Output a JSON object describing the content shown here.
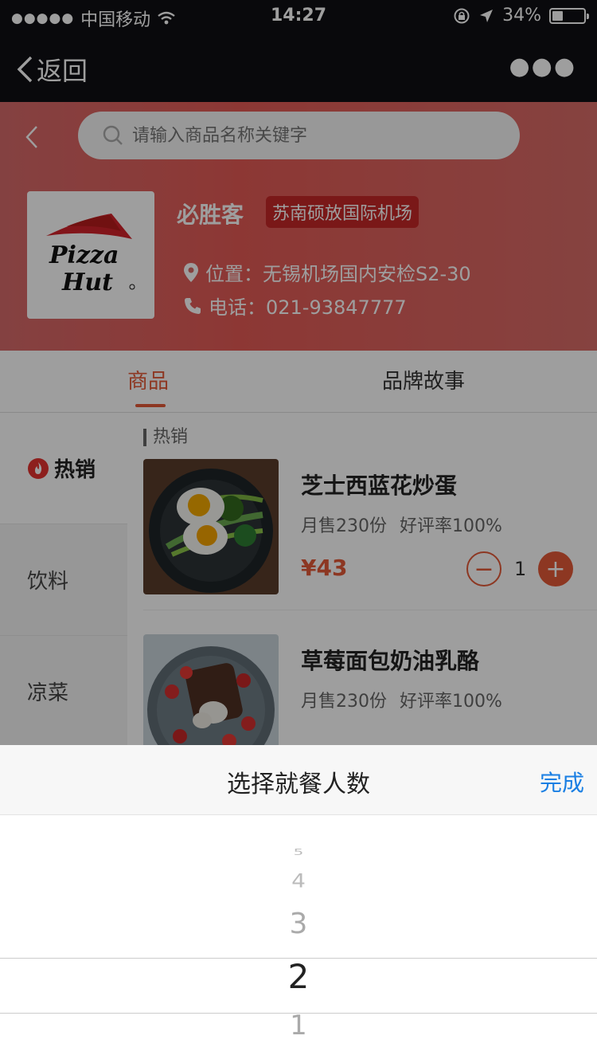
{
  "status_bar": {
    "carrier": "中国移动",
    "time": "14:27",
    "battery": "34%"
  },
  "nav": {
    "back_label": "返回"
  },
  "search": {
    "placeholder": "请输入商品名称关键字"
  },
  "store": {
    "name": "必胜客",
    "tag": "苏南硕放国际机场",
    "location": "位置：无锡机场国内安检S2-30",
    "phone": "电话：021-93847777"
  },
  "tabs": {
    "products": "商品",
    "brand_story": "品牌故事"
  },
  "sidebar": {
    "items": [
      {
        "label": "热销"
      },
      {
        "label": "饮料"
      },
      {
        "label": "凉菜"
      }
    ]
  },
  "section_title": "热销",
  "products": [
    {
      "name": "芝士西蓝花炒蛋",
      "monthly_sales": "月售230份",
      "rating": "好评率100%",
      "price": "¥43",
      "quantity": "1"
    },
    {
      "name": "草莓面包奶油乳酪",
      "monthly_sales": "月售230份",
      "rating": "好评率100%"
    }
  ],
  "picker": {
    "title": "选择就餐人数",
    "done_label": "完成",
    "options": [
      "5",
      "4",
      "3",
      "2",
      "1"
    ],
    "selected": "2"
  },
  "colors": {
    "accent": "#e45a37",
    "link": "#1a7fe3"
  }
}
